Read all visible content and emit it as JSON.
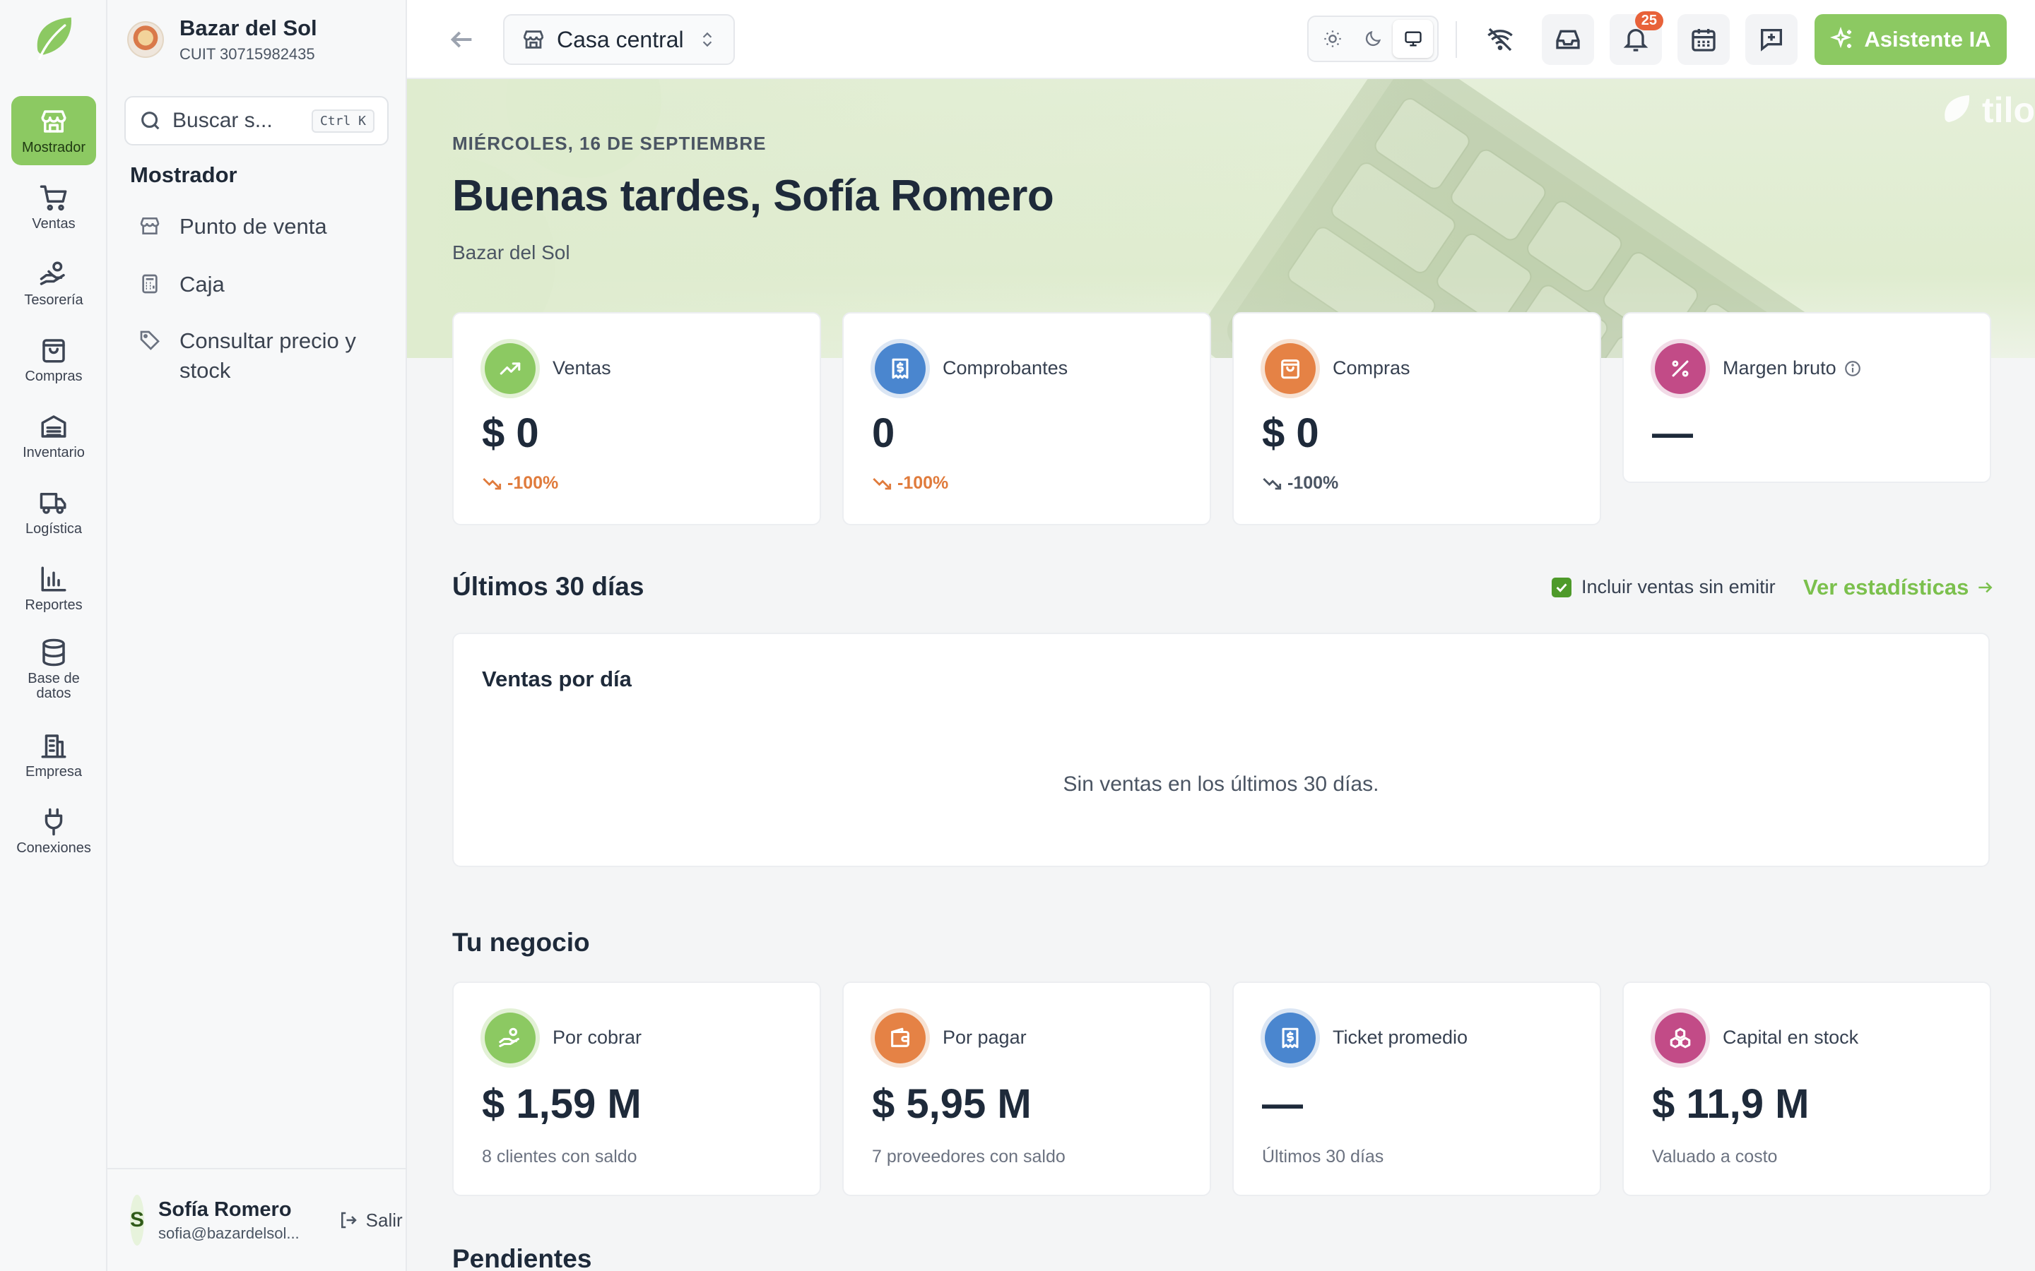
{
  "rail": {
    "items": [
      {
        "label": "Mostrador",
        "icon": "store-icon"
      },
      {
        "label": "Ventas",
        "icon": "cart-icon"
      },
      {
        "label": "Tesorería",
        "icon": "hand-coins-icon"
      },
      {
        "label": "Compras",
        "icon": "shopping-bag-icon"
      },
      {
        "label": "Inventario",
        "icon": "warehouse-icon"
      },
      {
        "label": "Logística",
        "icon": "truck-icon"
      },
      {
        "label": "Reportes",
        "icon": "bar-chart-icon"
      },
      {
        "label": "Base de datos",
        "icon": "database-icon"
      },
      {
        "label": "Empresa",
        "icon": "building-icon"
      },
      {
        "label": "Conexiones",
        "icon": "plug-icon"
      }
    ]
  },
  "org": {
    "name": "Bazar del Sol",
    "cuit": "CUIT 30715982435"
  },
  "search": {
    "placeholder": "Buscar s...",
    "shortcut": "Ctrl K"
  },
  "sidebar": {
    "title": "Mostrador",
    "items": [
      {
        "label": "Punto de venta",
        "icon": "store-icon"
      },
      {
        "label": "Caja",
        "icon": "calculator-icon"
      },
      {
        "label": "Consultar precio y stock",
        "icon": "tag-icon"
      }
    ]
  },
  "user": {
    "initial": "S",
    "name": "Sofía Romero",
    "email": "sofia@bazardelsol...",
    "logout": "Salir"
  },
  "topbar": {
    "branch": "Casa central",
    "notifications": "25",
    "ai_button": "Asistente IA"
  },
  "hero": {
    "date": "MIÉRCOLES, 16 DE SEPTIEMBRE",
    "greeting": "Buenas tardes, Sofía Romero",
    "business": "Bazar del Sol",
    "brand": "tilo"
  },
  "kpis": [
    {
      "title": "Ventas",
      "value": "$ 0",
      "delta": "-100%",
      "color": "#8cc962",
      "ring": "#e3f1d6",
      "delta_color": "#e07b3c",
      "icon": "trending-up-icon"
    },
    {
      "title": "Comprobantes",
      "value": "0",
      "delta": "-100%",
      "color": "#4a86cf",
      "ring": "#dbe6f4",
      "delta_color": "#e07b3c",
      "icon": "receipt-icon"
    },
    {
      "title": "Compras",
      "value": "$ 0",
      "delta": "-100%",
      "color": "#e58245",
      "ring": "#f7e2d3",
      "delta_color": "#4b5563",
      "icon": "shopping-bag-icon"
    },
    {
      "title": "Margen bruto",
      "value": "—",
      "color": "#c24b87",
      "ring": "#f2dbe7",
      "icon": "percent-icon"
    }
  ],
  "last30": {
    "title": "Últimos 30 días",
    "include_label": "Incluir ventas sin emitir",
    "include_checked": true,
    "stats_link": "Ver estadísticas",
    "chart_title": "Ventas por día",
    "empty": "Sin ventas en los últimos 30 días."
  },
  "business": {
    "title": "Tu negocio",
    "cards": [
      {
        "title": "Por cobrar",
        "value": "$ 1,59 M",
        "sub": "8 clientes con saldo",
        "color": "#8cc962",
        "ring": "#e3f1d6",
        "icon": "hand-coins-icon"
      },
      {
        "title": "Por pagar",
        "value": "$ 5,95 M",
        "sub": "7 proveedores con saldo",
        "color": "#e58245",
        "ring": "#f7e2d3",
        "icon": "wallet-icon"
      },
      {
        "title": "Ticket promedio",
        "value": "—",
        "sub": "Últimos 30 días",
        "color": "#4a86cf",
        "ring": "#dbe6f4",
        "icon": "receipt-icon"
      },
      {
        "title": "Capital en stock",
        "value": "$ 11,9 M",
        "sub": "Valuado a costo",
        "color": "#c24b87",
        "ring": "#f2dbe7",
        "icon": "boxes-icon"
      }
    ]
  },
  "pending": {
    "title": "Pendientes"
  }
}
